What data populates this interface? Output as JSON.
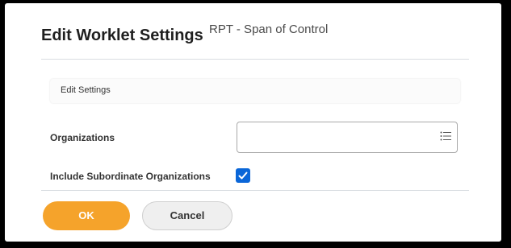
{
  "dialog": {
    "title": "Edit Worklet Settings",
    "subtitle": "RPT - Span of Control"
  },
  "section": {
    "label": "Edit Settings"
  },
  "fields": {
    "organizations_label": "Organizations",
    "organizations_value": "",
    "include_subordinates_label": "Include Subordinate Organizations",
    "include_subordinates_checked": true
  },
  "buttons": {
    "ok_label": "OK",
    "cancel_label": "Cancel"
  },
  "icons": {
    "prompt": "list-prompt-icon",
    "check": "checkmark-icon"
  },
  "colors": {
    "primary_button": "#f5a32b",
    "checkbox": "#0a66d8"
  }
}
